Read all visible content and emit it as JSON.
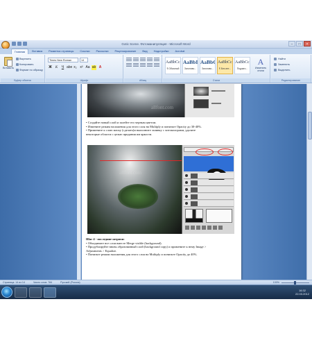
{
  "window": {
    "title": "Gotic Scene. Фотоманипуляция - Microsoft Word"
  },
  "tabs": [
    "Главная",
    "Вставка",
    "Разметка страницы",
    "Ссылки",
    "Рассылки",
    "Рецензирование",
    "Вид",
    "Надстройки",
    "Acrobat"
  ],
  "clipboard": {
    "paste_label": "Вставить",
    "cut_label": "Вырезать",
    "copy_label": "Копировать",
    "format_painter_label": "Формат по образцу",
    "group_label": "Буфер обмена"
  },
  "font": {
    "name": "Times New Roman",
    "size": "14",
    "group_label": "Шрифт"
  },
  "paragraph": {
    "group_label": "Абзац"
  },
  "styles": {
    "items": [
      {
        "sample": "AaBbCcI",
        "name": "¶ Обычный"
      },
      {
        "sample": "AaBbI",
        "name": "Заголово..."
      },
      {
        "sample": "AaBbC",
        "name": "Заголово..."
      },
      {
        "sample": "AaBbCcI",
        "name": "¶ Без инт..."
      },
      {
        "sample": "AaBbCcI",
        "name": "Подзаго..."
      }
    ],
    "change_label": "Изменить стили",
    "group_label": "Стили"
  },
  "editing": {
    "find_label": "Найти",
    "replace_label": "Заменить",
    "select_label": "Выделить",
    "group_label": "Редактирование"
  },
  "document": {
    "watermark_1": "allfont.com",
    "lines_a": [
      "• Создайте новый слой и залейте его черным цветом.",
      "• Измените режим наложения для этого слоя на Multiply и понизьте Opacity до 30-40%.",
      "• Примените к слою маску (сделать)и выполните заливку с хитоколорами, удалите",
      "  некоторые области с целью придания им яркости."
    ],
    "step_heading": "Шаг 4 - последние штрихи:",
    "lines_b": [
      "• Объедините все слои вместе Merge visible (background).",
      "• Продублируйте вновь образованный слой (background copy) и примените к нему Image >",
      "  Adjustments > Equalize.",
      "• Понизьте режим наложения для этого слоя на Multiply и понизьте Opacity до 40%."
    ]
  },
  "status": {
    "page": "Страница: 14 из 14",
    "words": "Число слов: 784",
    "language": "Русский (Россия)",
    "zoom": "100%"
  },
  "taskbar": {
    "time": "16:32",
    "date": "22.03.2012"
  },
  "colors": {
    "ribbon": "#dbe7f6",
    "workspace": "#5d8ac4",
    "taskbar": "#1f3a5c",
    "accent_red": "#e02525"
  }
}
